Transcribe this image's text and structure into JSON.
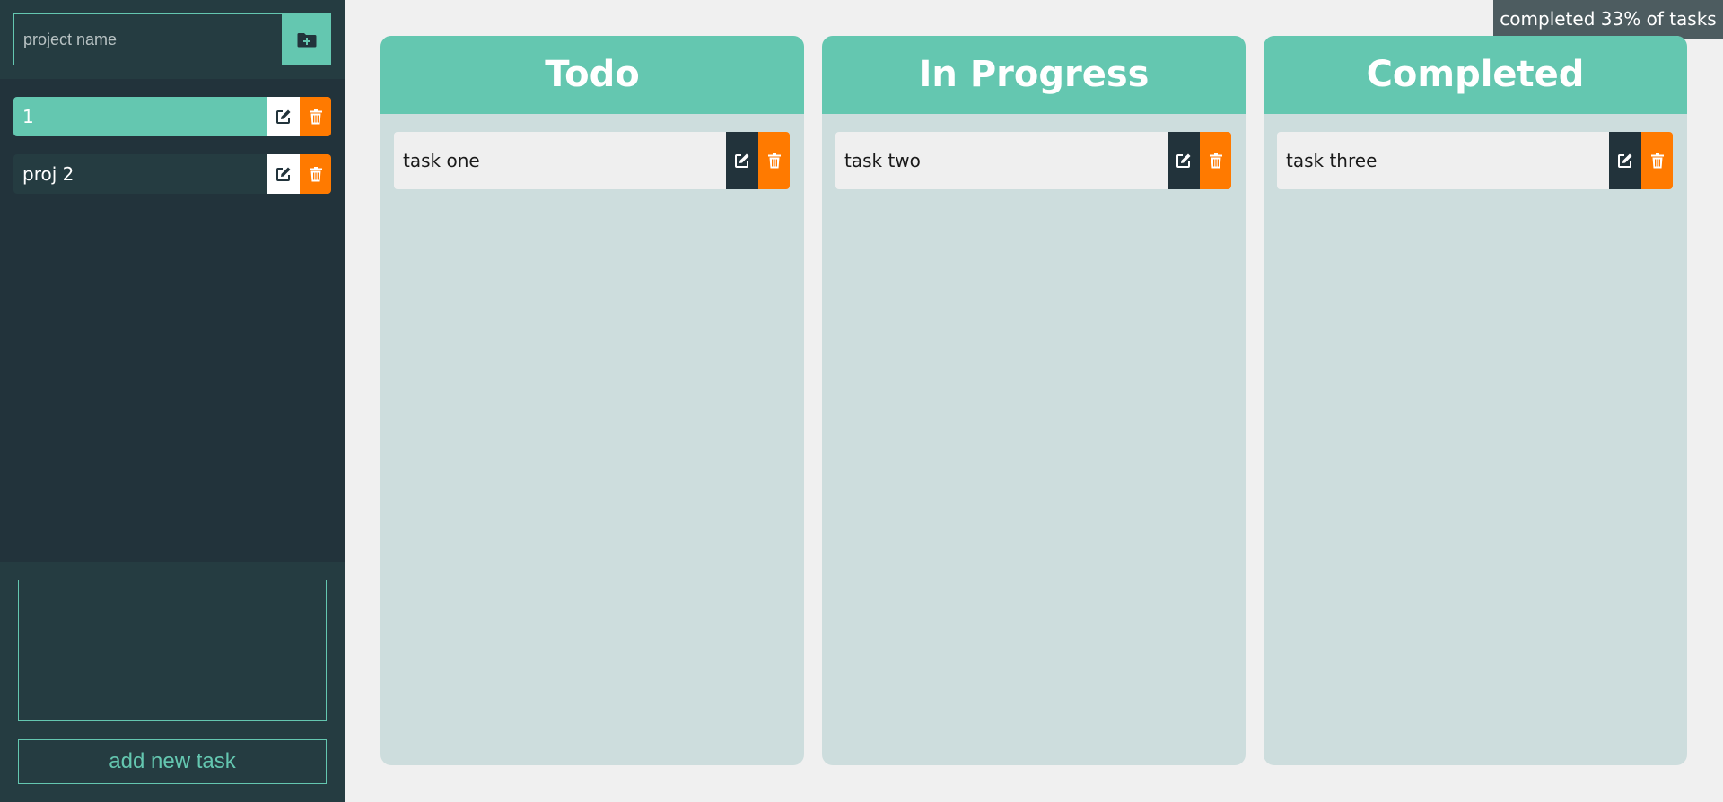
{
  "sidebar": {
    "project_input": {
      "placeholder": "project name",
      "value": ""
    },
    "add_project_icon": "folder-plus-icon",
    "projects": [
      {
        "name": "1",
        "active": true
      },
      {
        "name": "proj 2",
        "active": false
      }
    ],
    "task_input": {
      "value": ""
    },
    "add_task_label": "add new task"
  },
  "progress": {
    "text": "completed 33% of tasks",
    "percent": 33
  },
  "columns": [
    {
      "title": "Todo",
      "tasks": [
        "task one"
      ]
    },
    {
      "title": "In Progress",
      "tasks": [
        "task two"
      ]
    },
    {
      "title": "Completed",
      "tasks": [
        "task three"
      ]
    }
  ],
  "colors": {
    "accent": "#64c7b0",
    "sidebar": "#22333b",
    "danger": "#ff7a00",
    "column_bg": "#cddddd"
  }
}
